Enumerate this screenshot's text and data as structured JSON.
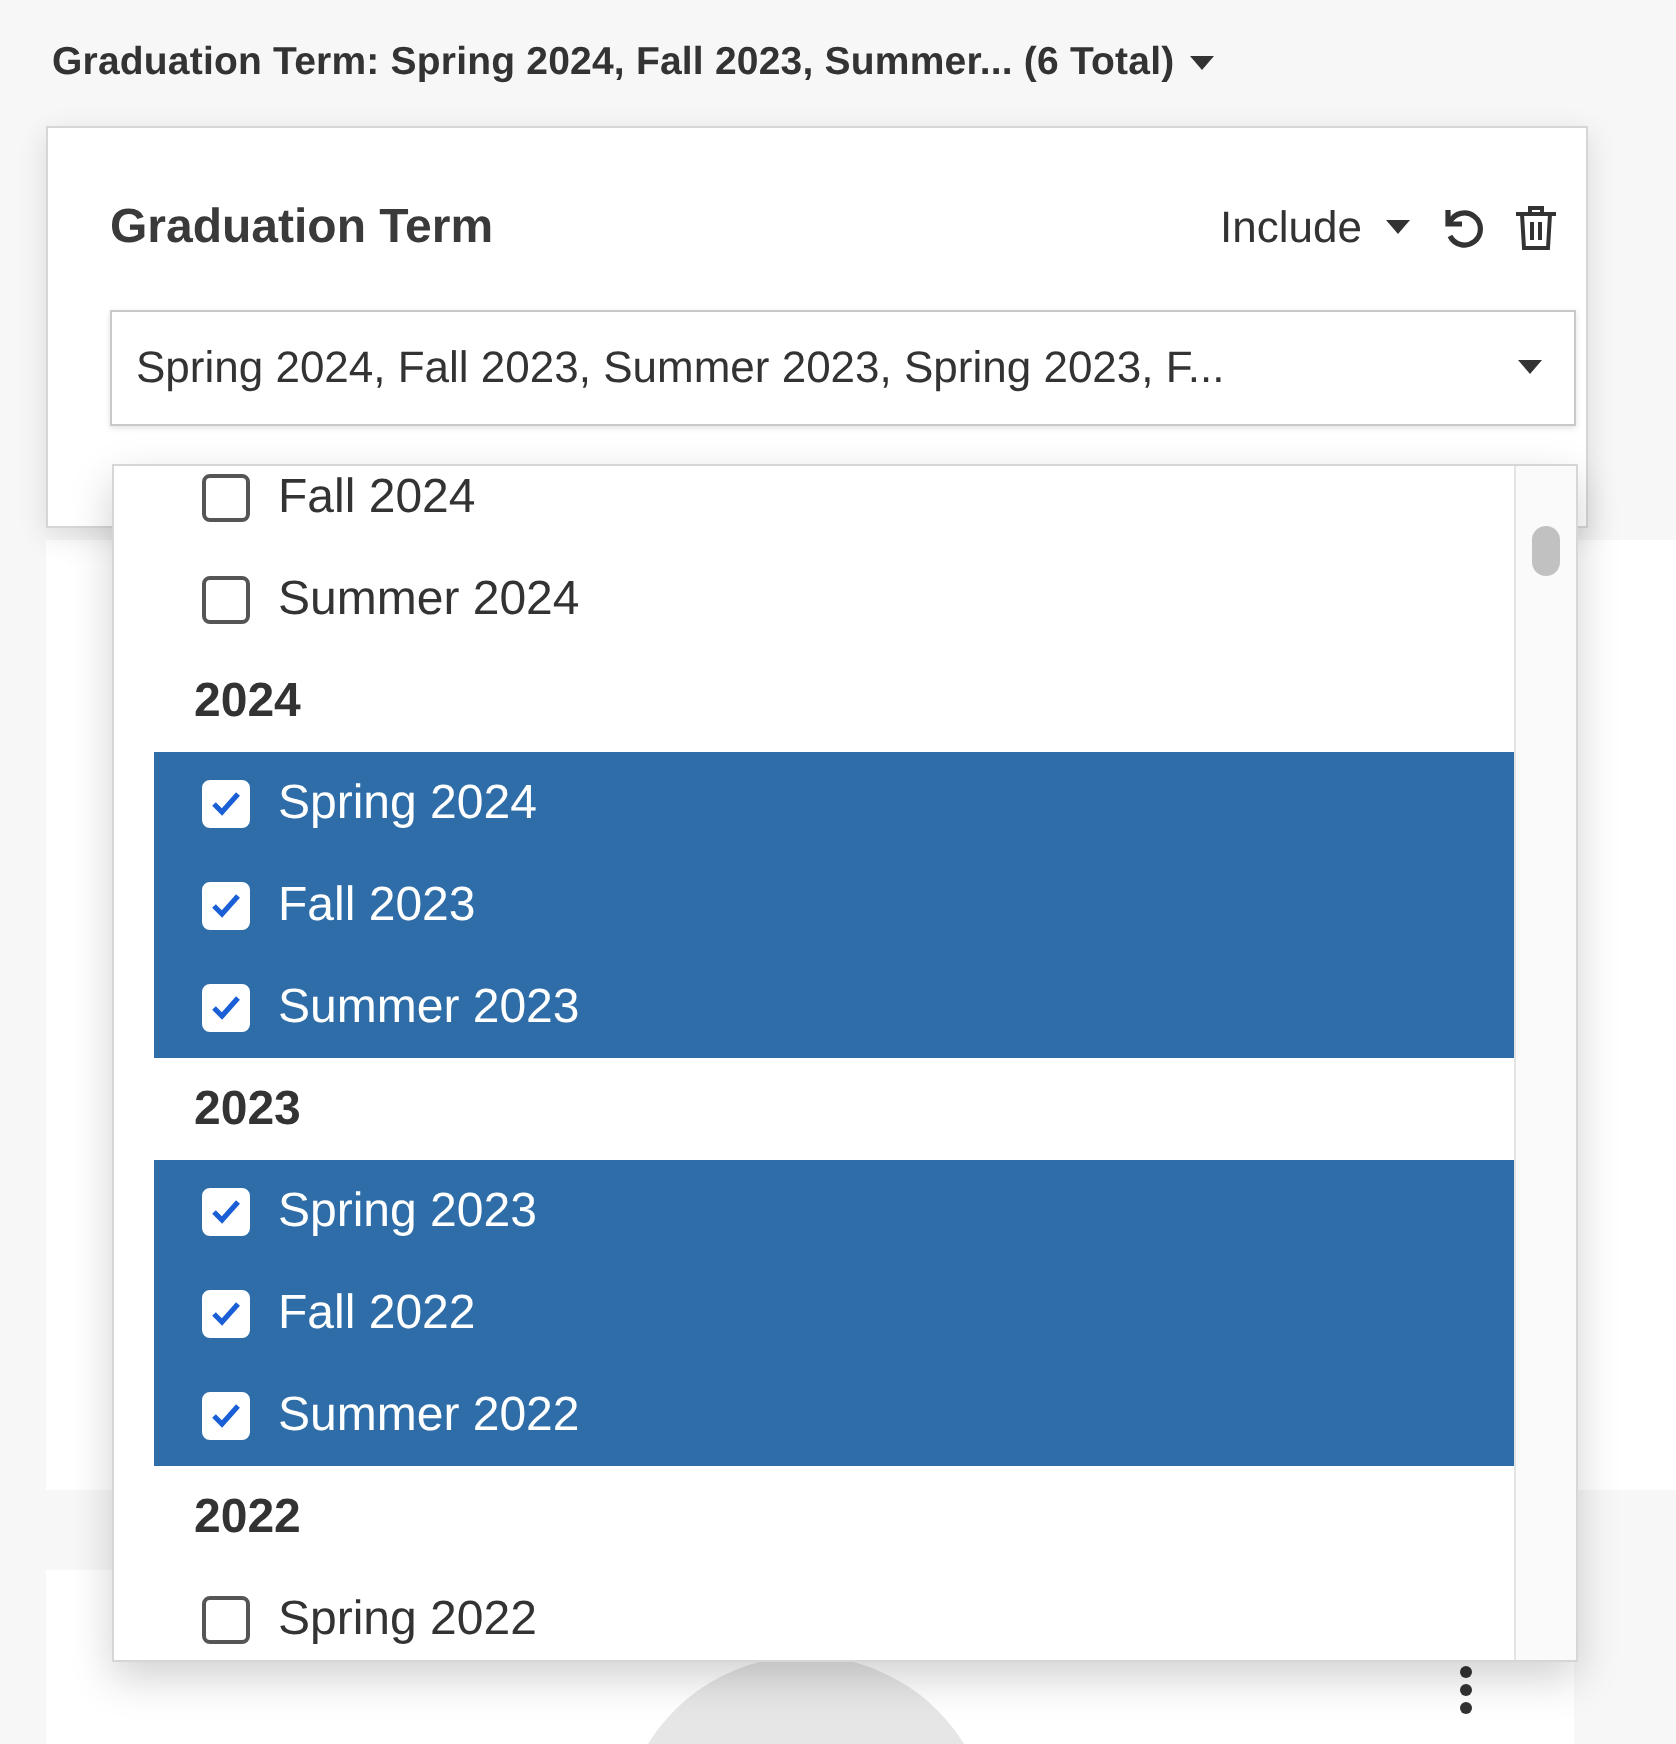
{
  "summary": {
    "label": "Graduation Term: Spring 2024, Fall 2023, Summer... (6 Total)"
  },
  "filter": {
    "title": "Graduation Term",
    "mode": "Include",
    "value": "Spring 2024, Fall 2023, Summer 2023, Spring 2023, F..."
  },
  "options": [
    {
      "kind": "option",
      "label": "Fall 2024",
      "checked": false
    },
    {
      "kind": "option",
      "label": "Summer 2024",
      "checked": false
    },
    {
      "kind": "heading",
      "label": "2024"
    },
    {
      "kind": "option",
      "label": "Spring 2024",
      "checked": true
    },
    {
      "kind": "option",
      "label": "Fall 2023",
      "checked": true
    },
    {
      "kind": "option",
      "label": "Summer 2023",
      "checked": true
    },
    {
      "kind": "heading",
      "label": "2023"
    },
    {
      "kind": "option",
      "label": "Spring 2023",
      "checked": true
    },
    {
      "kind": "option",
      "label": "Fall 2022",
      "checked": true
    },
    {
      "kind": "option",
      "label": "Summer 2022",
      "checked": true
    },
    {
      "kind": "heading",
      "label": "2022"
    },
    {
      "kind": "option",
      "label": "Spring 2022",
      "checked": false
    }
  ]
}
